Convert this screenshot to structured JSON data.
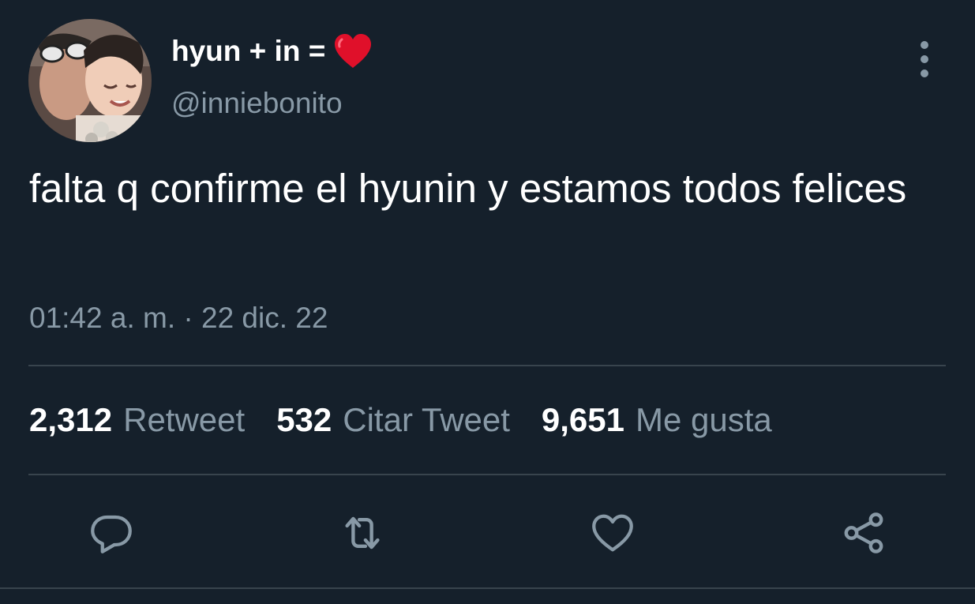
{
  "tweet": {
    "display_name": "hyun + in =",
    "name_emoji": "red-heart-emoji",
    "handle": "@inniebonito",
    "text": "falta q confirme el hyunin y estamos todos felices",
    "timestamp": "01:42 a. m. · 22 dic. 22"
  },
  "stats": {
    "retweets": "2,312",
    "retweets_label": "Retweet",
    "quotes": "532",
    "quotes_label": "Citar Tweet",
    "likes": "9,651",
    "likes_label": "Me gusta"
  },
  "actions": {
    "icons": [
      "reply-icon",
      "retweet-icon",
      "like-icon",
      "share-icon"
    ]
  },
  "colors": {
    "background": "#15202b",
    "primary_text": "#ffffff",
    "secondary_text": "#8899a6",
    "divider": "#38444d",
    "heart": "#e0102a"
  }
}
